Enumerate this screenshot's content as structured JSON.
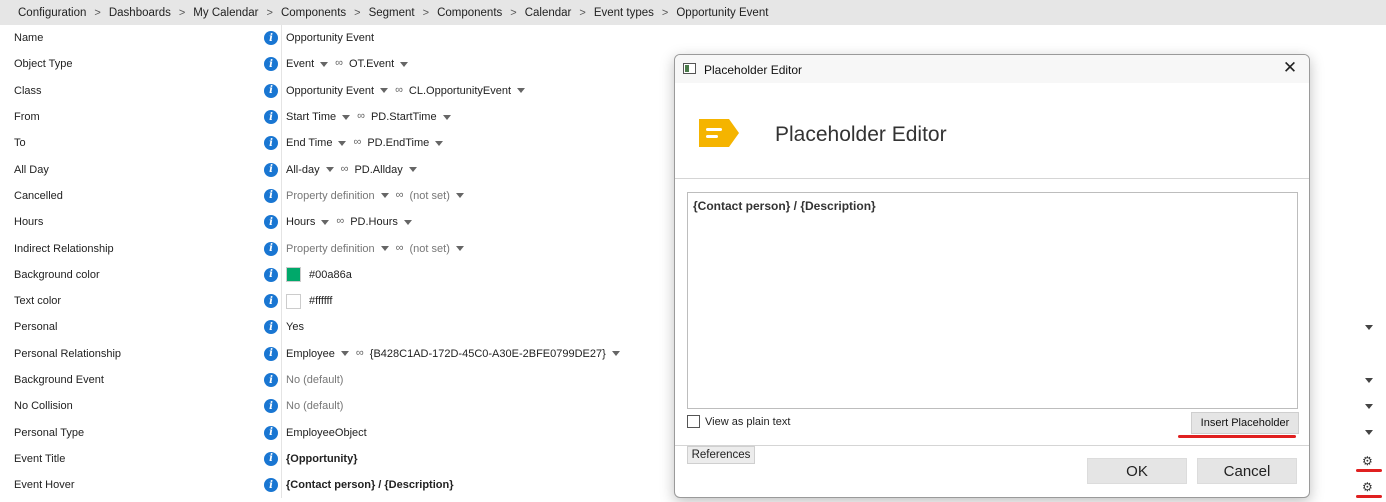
{
  "breadcrumb": [
    "Configuration",
    "Dashboards",
    "My Calendar",
    "Components",
    "Segment",
    "Components",
    "Calendar",
    "Event types",
    "Opportunity Event"
  ],
  "breadcrumb_separator": ">",
  "info_icon_glyph": "i",
  "link_icon_glyph": "∞",
  "gear_icon_glyph": "⚙",
  "rows": [
    {
      "label": "Name",
      "value": "Opportunity Event"
    },
    {
      "label": "Object Type",
      "value": "Event",
      "link": "OT.Event"
    },
    {
      "label": "Class",
      "value": "Opportunity Event",
      "link": "CL.OpportunityEvent"
    },
    {
      "label": "From",
      "value": "Start Time",
      "link": "PD.StartTime"
    },
    {
      "label": "To",
      "value": "End Time",
      "link": "PD.EndTime"
    },
    {
      "label": "All Day",
      "value": "All-day",
      "link": "PD.Allday"
    },
    {
      "label": "Cancelled",
      "value": "Property definition",
      "link": "(not set)"
    },
    {
      "label": "Hours",
      "value": "Hours",
      "link": "PD.Hours"
    },
    {
      "label": "Indirect Relationship",
      "value": "Property definition",
      "link": "(not set)"
    },
    {
      "label": "Background color",
      "value": "#00a86a",
      "swatch": "#00a86a"
    },
    {
      "label": "Text color",
      "value": "#ffffff",
      "swatch": "#ffffff"
    },
    {
      "label": "Personal",
      "value": "Yes"
    },
    {
      "label": "Personal Relationship",
      "value": "Employee",
      "link": "{B428C1AD-172D-45C0-A30E-2BFE0799DE27}"
    },
    {
      "label": "Background Event",
      "value": "No (default)"
    },
    {
      "label": "No Collision",
      "value": "No (default)"
    },
    {
      "label": "Personal Type",
      "value": "EmployeeObject"
    },
    {
      "label": "Event Title",
      "value": "{Opportunity}"
    },
    {
      "label": "Event Hover",
      "value": "{Contact person} / {Description}"
    }
  ],
  "dialog": {
    "window_title": "Placeholder Editor",
    "close_glyph": "✕",
    "heading": "Placeholder Editor",
    "editor_text": "{Contact person} / {Description}",
    "plain_text_label": "View as plain text",
    "insert_label": "Insert Placeholder",
    "references_label": "References",
    "ok_label": "OK",
    "cancel_label": "Cancel",
    "accent_color": "#f5b400"
  },
  "colors": {
    "info_blue": "#1976d2",
    "highlight_red": "#e02020"
  }
}
